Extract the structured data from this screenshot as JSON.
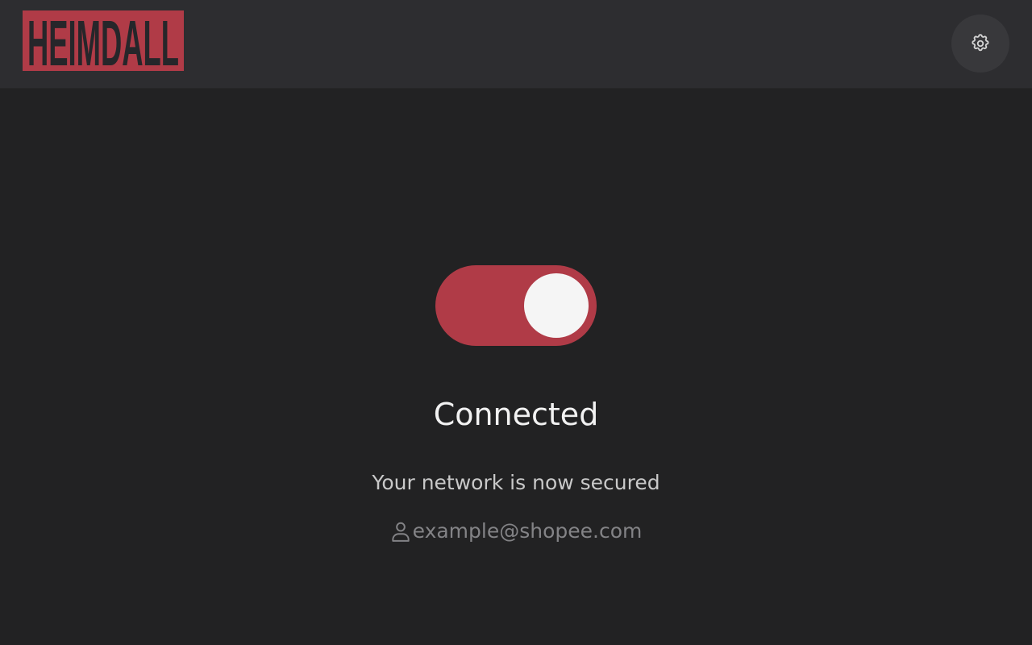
{
  "header": {
    "logo_text": "HEIMDALL",
    "settings_icon": "gear-icon"
  },
  "colors": {
    "accent": "#b03b47",
    "header_bg": "#2d2d30",
    "main_bg": "#222223",
    "knob": "#f5f5f5"
  },
  "vpn": {
    "connected": true,
    "status_title": "Connected",
    "status_subtitle": "Your network is now secured",
    "account_icon": "user-icon",
    "account_email": "example@shopee.com"
  }
}
